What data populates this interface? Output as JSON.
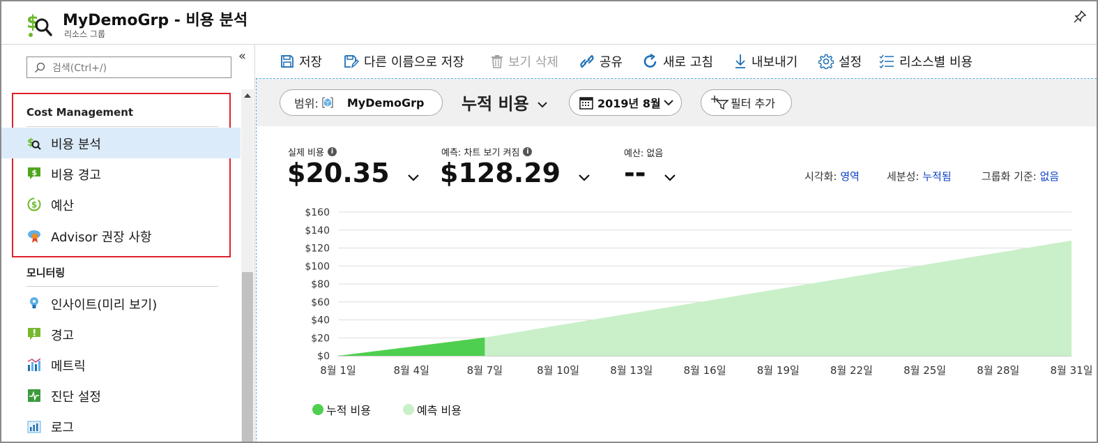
{
  "header": {
    "title": "MyDemoGrp  - 비용 분석",
    "subtitle": "리소스 그룹"
  },
  "sidebar": {
    "search_placeholder": "검색(Ctrl+/)",
    "sections": [
      {
        "title": "Cost Management",
        "items": [
          {
            "label": "비용 분석",
            "icon": "cost-analysis-icon",
            "active": true
          },
          {
            "label": "비용 경고",
            "icon": "cost-alert-icon"
          },
          {
            "label": "예산",
            "icon": "budget-icon"
          },
          {
            "label": "Advisor 권장 사항",
            "icon": "advisor-icon"
          }
        ]
      },
      {
        "title": "모니터링",
        "items": [
          {
            "label": "인사이트(미리 보기)",
            "icon": "insights-icon"
          },
          {
            "label": "경고",
            "icon": "alert-icon"
          },
          {
            "label": "메트릭",
            "icon": "metrics-icon"
          },
          {
            "label": "진단 설정",
            "icon": "diagnostics-icon"
          },
          {
            "label": "로그",
            "icon": "logs-icon"
          }
        ]
      }
    ]
  },
  "toolbar": {
    "save": "저장",
    "save_as": "다른 이름으로 저장",
    "delete_view": "보기 삭제",
    "share": "공유",
    "refresh": "새로 고침",
    "export": "내보내기",
    "settings": "설정",
    "cost_by_resource": "리소스별 비용"
  },
  "filters": {
    "scope_label": "범위:",
    "scope_value": "MyDemoGrp",
    "view_name": "누적 비용",
    "date": "2019년 8월",
    "add_filter": "필터 추가"
  },
  "kpis": {
    "actual_label": "실제 비용",
    "actual_value": "$20.35",
    "forecast_label": "예측: 차트 보기 켜짐",
    "forecast_value": "$128.29",
    "budget_label": "예산: 없음",
    "budget_value": "--"
  },
  "options": {
    "visualization_label": "시각화:",
    "visualization_value": "영역",
    "granularity_label": "세분성:",
    "granularity_value": "누적됨",
    "groupby_label": "그룹화 기준:",
    "groupby_value": "없음"
  },
  "colors": {
    "accumulated": "#4fcf4f",
    "forecast": "#c9f0c9",
    "accent_blue": "#0a3fc8",
    "highlight_red": "#e0202a"
  },
  "chart_data": {
    "type": "area",
    "title": "",
    "xlabel": "",
    "ylabel": "",
    "x_ticks": [
      "8월 1일",
      "8월 4일",
      "8월 7일",
      "8월 10일",
      "8월 13일",
      "8월 16일",
      "8월 19일",
      "8월 22일",
      "8월 25일",
      "8월 28일",
      "8월 31일"
    ],
    "y_ticks": [
      "$0",
      "$20",
      "$40",
      "$60",
      "$80",
      "$100",
      "$120",
      "$140",
      "$160"
    ],
    "ylim": [
      0,
      160
    ],
    "xlim": [
      1,
      31
    ],
    "grid": true,
    "legend_position": "bottom-left",
    "series": [
      {
        "name": "누적 비용",
        "x": [
          1,
          7
        ],
        "y": [
          0,
          20.35
        ]
      },
      {
        "name": "예측 비용",
        "x": [
          7,
          31
        ],
        "y": [
          20.35,
          128.29
        ]
      }
    ]
  }
}
